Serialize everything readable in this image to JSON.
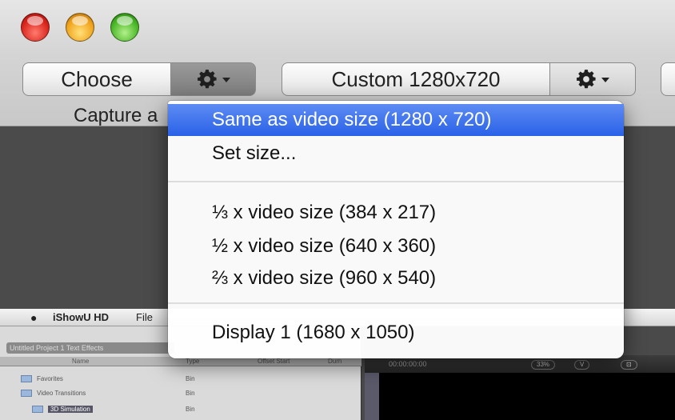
{
  "window": {
    "controls": [
      "close",
      "minimize",
      "zoom"
    ]
  },
  "toolbar": {
    "choose_label": "Choose",
    "size_label": "Custom 1280x720",
    "caption": "Capture a",
    "icons": [
      "gear-icon",
      "chevron-down-icon"
    ]
  },
  "menu": {
    "items": [
      {
        "label": "Same as video size (1280 x 720)",
        "selected": true
      },
      {
        "label": "Set size..."
      },
      {
        "label": "⅓ x video size (384 x 217)"
      },
      {
        "label": "½ x video size (640 x 360)"
      },
      {
        "label": "⅔ x video size (960 x 540)"
      },
      {
        "label": "Display 1 (1680 x 1050)"
      }
    ],
    "highlight_color": "#2961e8"
  },
  "background_app": {
    "menubar": {
      "apple": "",
      "name": "iShowU HD",
      "file": "File"
    },
    "tabs": "Untitled Project 1   Text   Effects",
    "columns": [
      "Name",
      "Type",
      "Offset Start",
      "Durn"
    ],
    "rows": [
      {
        "name": "Favorites",
        "type": "Bin"
      },
      {
        "name": "Video Transitions",
        "type": "Bin"
      },
      {
        "name": "3D Simulation",
        "type": "Bin"
      }
    ],
    "viewer_time": "00:00:00:00",
    "viewer_buttons": [
      "33%",
      "V",
      "⊡"
    ]
  }
}
